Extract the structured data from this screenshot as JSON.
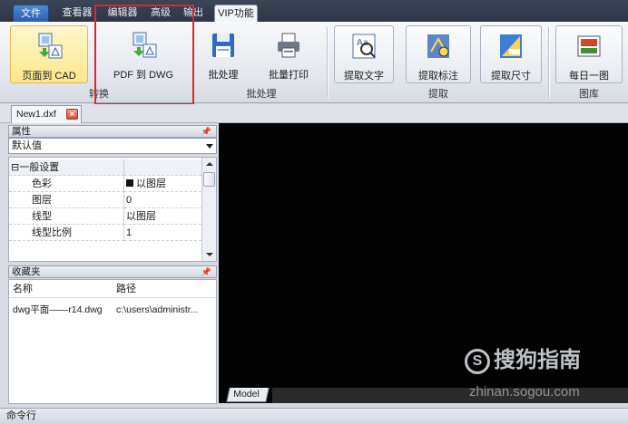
{
  "ribbon_tabs": [
    "文件",
    "查看器",
    "编辑器",
    "高级",
    "输出",
    "VIP功能"
  ],
  "ribbon": {
    "buttons": {
      "pdf_to_cad": "页面到 CAD",
      "pdf_to_dwg": "PDF 到 DWG",
      "batch": "批处理",
      "batch_print": "批量打印",
      "extract_text": "提取文字",
      "extract_dims": "提取标注",
      "extract_size": "提取尺寸",
      "daily_pic": "每日一图"
    },
    "groups": {
      "convert": "转换",
      "batch": "批处理",
      "extract": "提取",
      "gallery": "图库"
    }
  },
  "document_tab": "New1.dxf",
  "properties_panel": {
    "title": "属性",
    "dropdown_value": "默认值",
    "section": "一般设置",
    "rows": [
      {
        "key": "色彩",
        "value": "以图层"
      },
      {
        "key": "图层",
        "value": "0"
      },
      {
        "key": "线型",
        "value": "以图层"
      },
      {
        "key": "线型比例",
        "value": "1"
      }
    ]
  },
  "favorites_panel": {
    "title": "收藏夹",
    "columns": [
      "名称",
      "路径"
    ],
    "rows": [
      {
        "name": "dwg平面——r14.dwg",
        "path": "c:\\users\\administr..."
      }
    ]
  },
  "canvas": {
    "model_tab": "Model",
    "watermark": "搜狗指南",
    "watermark_url": "zhinan.sogou.com"
  },
  "command_bar": "命令行"
}
